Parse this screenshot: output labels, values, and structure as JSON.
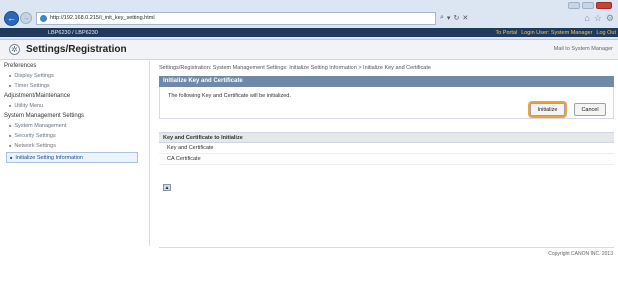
{
  "browser": {
    "url": "http://192.168.0.215/i_init_key_setting.html",
    "address_tools": [
      "▾",
      "↻",
      "✕"
    ]
  },
  "model_bar": {
    "model": "LBP6230 / LBP6230",
    "to_portal": "To Portal",
    "login_user": "Login User: System Manager",
    "logout": "Log Out"
  },
  "header": {
    "title": "Settings/Registration",
    "mail_link": "Mail to System Manager"
  },
  "sidebar": {
    "sections": [
      {
        "label": "Preferences",
        "items": [
          "Display Settings",
          "Timer Settings"
        ]
      },
      {
        "label": "Adjustment/Maintenance",
        "items": [
          "Utility Menu"
        ]
      },
      {
        "label": "System Management Settings",
        "items": [
          "System Management",
          "Security Settings",
          "Network Settings",
          "Initialize Setting Information"
        ]
      }
    ],
    "active_item": "Initialize Setting Information"
  },
  "main": {
    "breadcrumb": "Settings/Registration: System Management Settings: Initialize Setting Information > Initialize Key and Certificate",
    "panel_title": "Initialize Key and Certificate",
    "message": "The following Key and Certificate will be initialized.",
    "initialize_label": "Initialize",
    "cancel_label": "Cancel",
    "section_title": "Key and Certificate to Initialize",
    "rows": [
      "Key and Certificate",
      "CA Certificate"
    ],
    "top_button": "▲"
  },
  "footer": {
    "copyright": "Copyright CANON INC. 2013"
  },
  "colors": {
    "model_bar": "#203a5e",
    "panel_head": "#6e8aa8",
    "highlight": "#f0a13c"
  }
}
